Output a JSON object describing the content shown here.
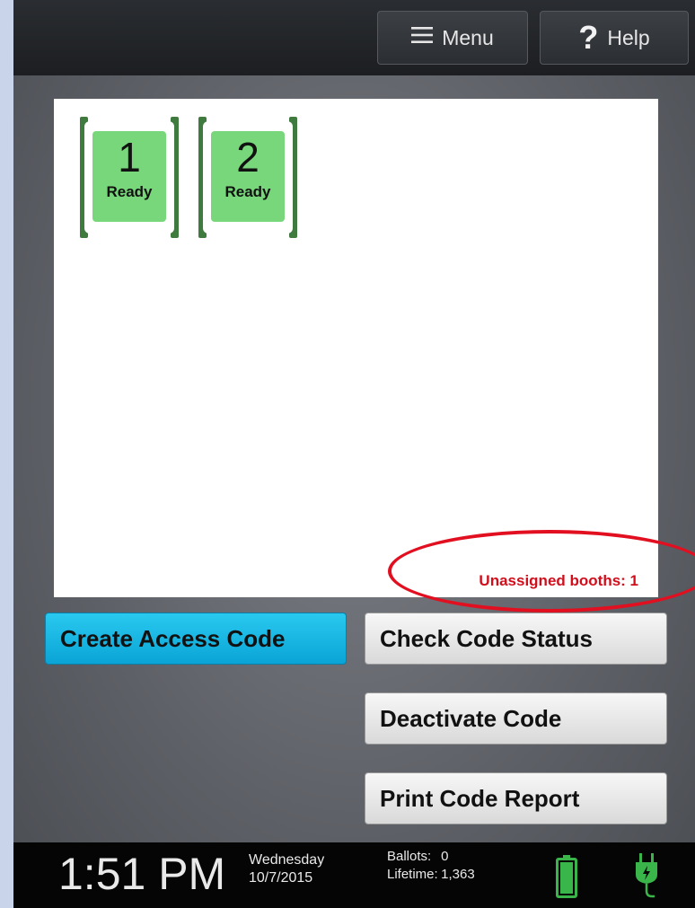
{
  "header": {
    "menu_label": "Menu",
    "help_label": "Help",
    "help_glyph": "?"
  },
  "booths": [
    {
      "number": "1",
      "status": "Ready"
    },
    {
      "number": "2",
      "status": "Ready"
    }
  ],
  "panel": {
    "unassigned_text": "Unassigned booths: 1"
  },
  "actions": {
    "create": "Create Access Code",
    "check": "Check Code Status",
    "deactivate": "Deactivate Code",
    "print": "Print Code Report"
  },
  "statusbar": {
    "time": "1:51 PM",
    "weekday": "Wednesday",
    "date": "10/7/2015",
    "ballots_label": "Ballots:",
    "ballots_value": "0",
    "lifetime_label": "Lifetime:",
    "lifetime_value": "1,363",
    "battery_icon": "battery-icon",
    "power_icon": "power-plug-icon"
  },
  "colors": {
    "booth_ready": "#77d77a",
    "primary_button": "#1bb6e3",
    "alert_red": "#d10f1c"
  }
}
